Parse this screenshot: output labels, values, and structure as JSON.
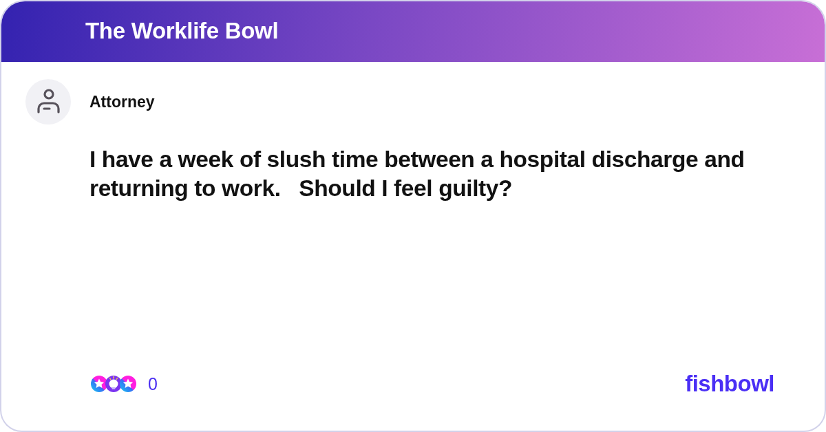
{
  "header": {
    "title": "The Worklife Bowl"
  },
  "post": {
    "author": "Attorney",
    "question": "I have a week of slush time between a hospital discharge and returning to work.   Should I feel guilty?"
  },
  "footer": {
    "reaction_count": "0",
    "logo": "fishbowl"
  }
}
